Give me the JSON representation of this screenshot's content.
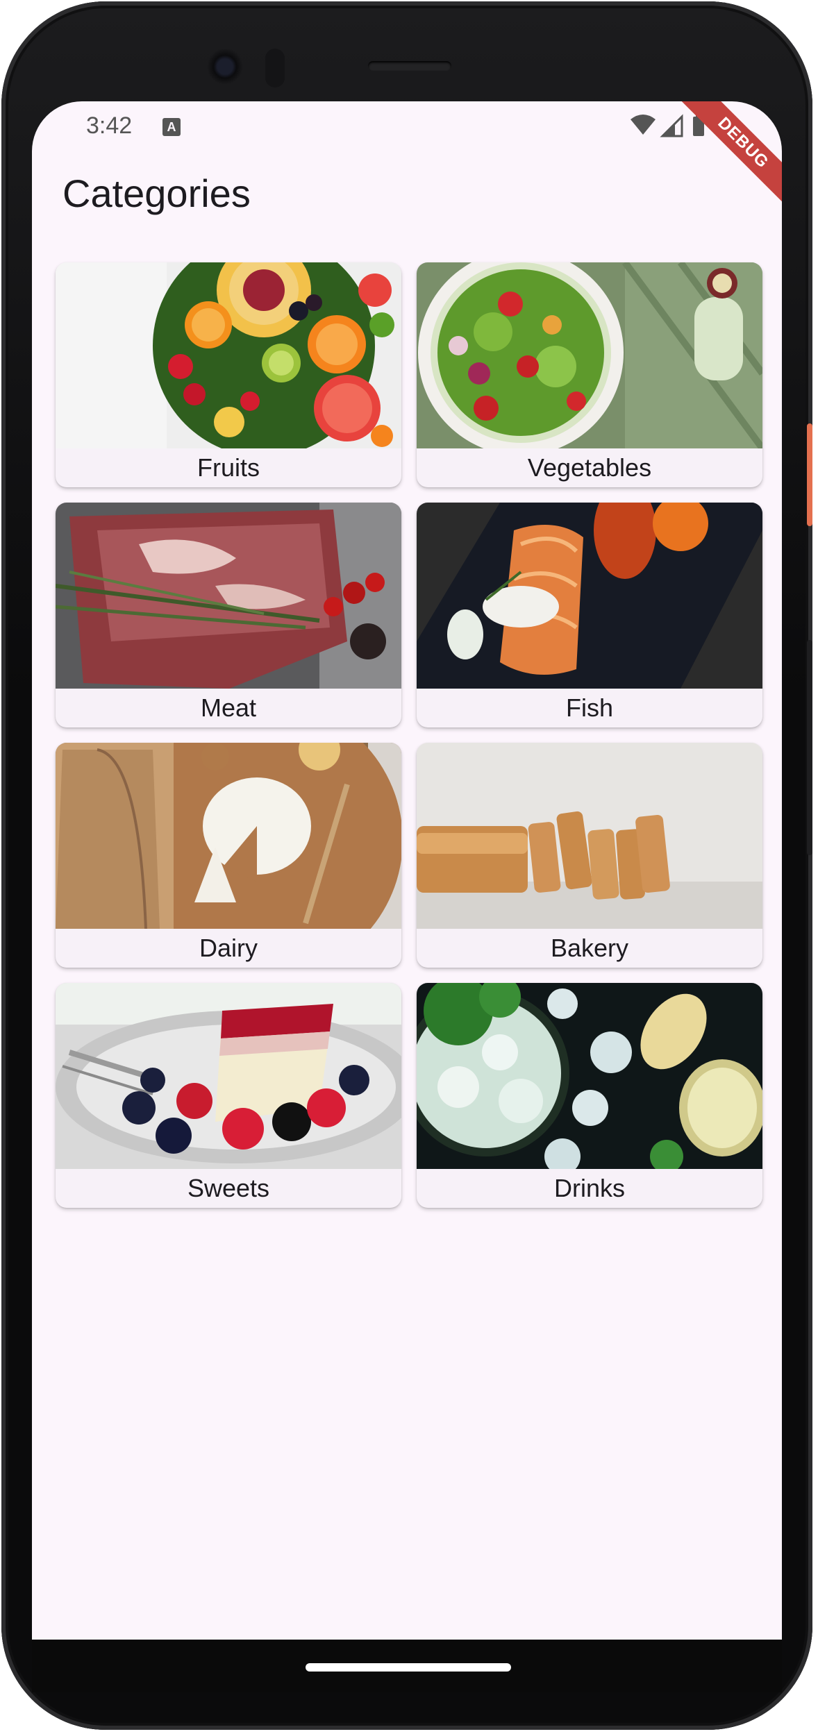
{
  "status_bar": {
    "time": "3:42",
    "notification_icon": "A",
    "icons": [
      "wifi-icon",
      "signal-icon",
      "battery-icon"
    ],
    "debug_banner": "DEBUG"
  },
  "app_bar": {
    "title": "Categories"
  },
  "categories": [
    {
      "label": "Fruits"
    },
    {
      "label": "Vegetables"
    },
    {
      "label": "Meat"
    },
    {
      "label": "Fish"
    },
    {
      "label": "Dairy"
    },
    {
      "label": "Bakery"
    },
    {
      "label": "Sweets"
    },
    {
      "label": "Drinks"
    }
  ],
  "colors": {
    "background": "#fcf5fc",
    "card": "#f7f1f8",
    "debug_banner": "#c5423e",
    "text": "#1d1b20"
  }
}
